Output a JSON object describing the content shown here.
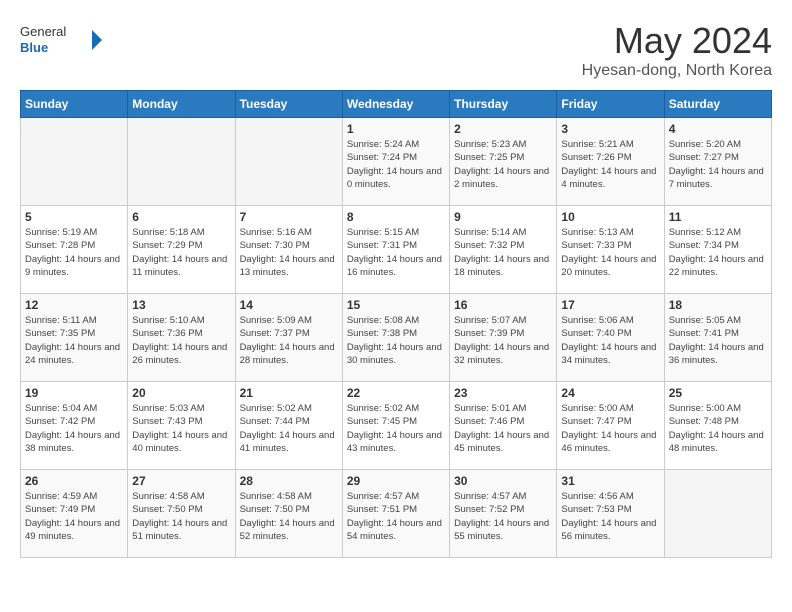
{
  "header": {
    "logo": {
      "text_general": "General",
      "text_blue": "Blue"
    },
    "title": "May 2024",
    "location": "Hyesan-dong, North Korea"
  },
  "days_of_week": [
    "Sunday",
    "Monday",
    "Tuesday",
    "Wednesday",
    "Thursday",
    "Friday",
    "Saturday"
  ],
  "weeks": [
    {
      "days": [
        {
          "num": "",
          "empty": true
        },
        {
          "num": "",
          "empty": true
        },
        {
          "num": "",
          "empty": true
        },
        {
          "num": "1",
          "sunrise": "5:24 AM",
          "sunset": "7:24 PM",
          "daylight": "14 hours and 0 minutes."
        },
        {
          "num": "2",
          "sunrise": "5:23 AM",
          "sunset": "7:25 PM",
          "daylight": "14 hours and 2 minutes."
        },
        {
          "num": "3",
          "sunrise": "5:21 AM",
          "sunset": "7:26 PM",
          "daylight": "14 hours and 4 minutes."
        },
        {
          "num": "4",
          "sunrise": "5:20 AM",
          "sunset": "7:27 PM",
          "daylight": "14 hours and 7 minutes."
        }
      ]
    },
    {
      "days": [
        {
          "num": "5",
          "sunrise": "5:19 AM",
          "sunset": "7:28 PM",
          "daylight": "14 hours and 9 minutes."
        },
        {
          "num": "6",
          "sunrise": "5:18 AM",
          "sunset": "7:29 PM",
          "daylight": "14 hours and 11 minutes."
        },
        {
          "num": "7",
          "sunrise": "5:16 AM",
          "sunset": "7:30 PM",
          "daylight": "14 hours and 13 minutes."
        },
        {
          "num": "8",
          "sunrise": "5:15 AM",
          "sunset": "7:31 PM",
          "daylight": "14 hours and 16 minutes."
        },
        {
          "num": "9",
          "sunrise": "5:14 AM",
          "sunset": "7:32 PM",
          "daylight": "14 hours and 18 minutes."
        },
        {
          "num": "10",
          "sunrise": "5:13 AM",
          "sunset": "7:33 PM",
          "daylight": "14 hours and 20 minutes."
        },
        {
          "num": "11",
          "sunrise": "5:12 AM",
          "sunset": "7:34 PM",
          "daylight": "14 hours and 22 minutes."
        }
      ]
    },
    {
      "days": [
        {
          "num": "12",
          "sunrise": "5:11 AM",
          "sunset": "7:35 PM",
          "daylight": "14 hours and 24 minutes."
        },
        {
          "num": "13",
          "sunrise": "5:10 AM",
          "sunset": "7:36 PM",
          "daylight": "14 hours and 26 minutes."
        },
        {
          "num": "14",
          "sunrise": "5:09 AM",
          "sunset": "7:37 PM",
          "daylight": "14 hours and 28 minutes."
        },
        {
          "num": "15",
          "sunrise": "5:08 AM",
          "sunset": "7:38 PM",
          "daylight": "14 hours and 30 minutes."
        },
        {
          "num": "16",
          "sunrise": "5:07 AM",
          "sunset": "7:39 PM",
          "daylight": "14 hours and 32 minutes."
        },
        {
          "num": "17",
          "sunrise": "5:06 AM",
          "sunset": "7:40 PM",
          "daylight": "14 hours and 34 minutes."
        },
        {
          "num": "18",
          "sunrise": "5:05 AM",
          "sunset": "7:41 PM",
          "daylight": "14 hours and 36 minutes."
        }
      ]
    },
    {
      "days": [
        {
          "num": "19",
          "sunrise": "5:04 AM",
          "sunset": "7:42 PM",
          "daylight": "14 hours and 38 minutes."
        },
        {
          "num": "20",
          "sunrise": "5:03 AM",
          "sunset": "7:43 PM",
          "daylight": "14 hours and 40 minutes."
        },
        {
          "num": "21",
          "sunrise": "5:02 AM",
          "sunset": "7:44 PM",
          "daylight": "14 hours and 41 minutes."
        },
        {
          "num": "22",
          "sunrise": "5:02 AM",
          "sunset": "7:45 PM",
          "daylight": "14 hours and 43 minutes."
        },
        {
          "num": "23",
          "sunrise": "5:01 AM",
          "sunset": "7:46 PM",
          "daylight": "14 hours and 45 minutes."
        },
        {
          "num": "24",
          "sunrise": "5:00 AM",
          "sunset": "7:47 PM",
          "daylight": "14 hours and 46 minutes."
        },
        {
          "num": "25",
          "sunrise": "5:00 AM",
          "sunset": "7:48 PM",
          "daylight": "14 hours and 48 minutes."
        }
      ]
    },
    {
      "days": [
        {
          "num": "26",
          "sunrise": "4:59 AM",
          "sunset": "7:49 PM",
          "daylight": "14 hours and 49 minutes."
        },
        {
          "num": "27",
          "sunrise": "4:58 AM",
          "sunset": "7:50 PM",
          "daylight": "14 hours and 51 minutes."
        },
        {
          "num": "28",
          "sunrise": "4:58 AM",
          "sunset": "7:50 PM",
          "daylight": "14 hours and 52 minutes."
        },
        {
          "num": "29",
          "sunrise": "4:57 AM",
          "sunset": "7:51 PM",
          "daylight": "14 hours and 54 minutes."
        },
        {
          "num": "30",
          "sunrise": "4:57 AM",
          "sunset": "7:52 PM",
          "daylight": "14 hours and 55 minutes."
        },
        {
          "num": "31",
          "sunrise": "4:56 AM",
          "sunset": "7:53 PM",
          "daylight": "14 hours and 56 minutes."
        },
        {
          "num": "",
          "empty": true
        }
      ]
    }
  ]
}
